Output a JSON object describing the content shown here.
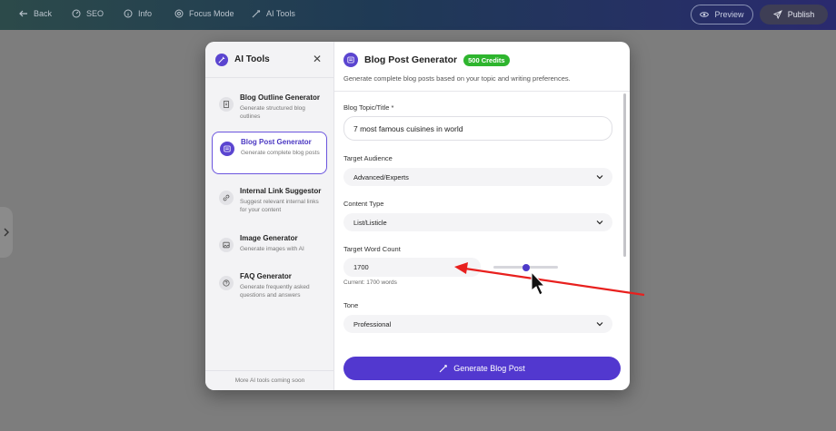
{
  "topbar": {
    "back": "Back",
    "seo": "SEO",
    "info": "Info",
    "focus_mode": "Focus Mode",
    "ai_tools": "AI Tools",
    "preview": "Preview",
    "publish": "Publish"
  },
  "sidebar": {
    "title": "AI Tools",
    "items": [
      {
        "name": "Blog Outline Generator",
        "desc": "Generate structured blog outlines",
        "icon": "document-icon"
      },
      {
        "name": "Blog Post Generator",
        "desc": "Generate complete blog posts",
        "icon": "post-icon",
        "active": true
      },
      {
        "name": "Internal Link Suggestor",
        "desc": "Suggest relevant internal links for your content",
        "icon": "link-icon"
      },
      {
        "name": "Image Generator",
        "desc": "Generate images with AI",
        "icon": "image-icon"
      },
      {
        "name": "FAQ Generator",
        "desc": "Generate frequently asked questions and answers",
        "icon": "question-icon"
      }
    ],
    "footer": "More AI tools coming soon"
  },
  "main": {
    "title": "Blog Post Generator",
    "credits": "500 Credits",
    "subtitle": "Generate complete blog posts based on your topic and writing preferences.",
    "topic_label": "Blog Topic/Title *",
    "topic_value": "7 most famous cuisines in world",
    "audience_label": "Target Audience",
    "audience_value": "Advanced/Experts",
    "content_type_label": "Content Type",
    "content_type_value": "List/Listicle",
    "word_count_label": "Target Word Count",
    "word_count_value": "1700",
    "word_count_helper": "Current: 1700 words",
    "word_count_slider_fraction": 0.5,
    "tone_label": "Tone",
    "tone_value": "Professional",
    "generate_button": "Generate Blog Post"
  },
  "colors": {
    "accent": "#5238cf",
    "credits_badge": "#2eb52e",
    "annotation_arrow": "#e8201e"
  }
}
